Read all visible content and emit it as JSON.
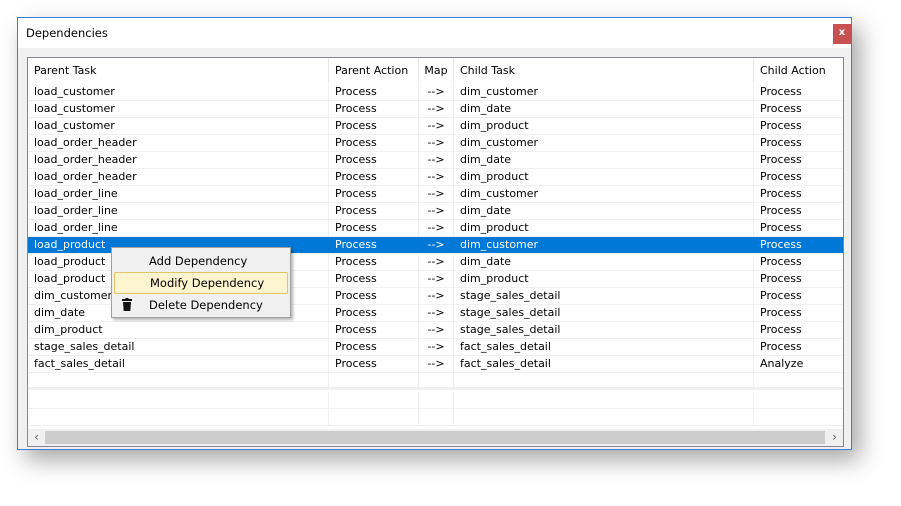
{
  "window": {
    "title": "Dependencies",
    "close_label": "x"
  },
  "columns": [
    "Parent Task",
    "Parent Action",
    "Map",
    "Child Task",
    "Child Action"
  ],
  "rows": [
    [
      "load_customer",
      "Process",
      "-->",
      "dim_customer",
      "Process"
    ],
    [
      "load_customer",
      "Process",
      "-->",
      "dim_date",
      "Process"
    ],
    [
      "load_customer",
      "Process",
      "-->",
      "dim_product",
      "Process"
    ],
    [
      "load_order_header",
      "Process",
      "-->",
      "dim_customer",
      "Process"
    ],
    [
      "load_order_header",
      "Process",
      "-->",
      "dim_date",
      "Process"
    ],
    [
      "load_order_header",
      "Process",
      "-->",
      "dim_product",
      "Process"
    ],
    [
      "load_order_line",
      "Process",
      "-->",
      "dim_customer",
      "Process"
    ],
    [
      "load_order_line",
      "Process",
      "-->",
      "dim_date",
      "Process"
    ],
    [
      "load_order_line",
      "Process",
      "-->",
      "dim_product",
      "Process"
    ],
    [
      "load_product",
      "Process",
      "-->",
      "dim_customer",
      "Process"
    ],
    [
      "load_product",
      "Process",
      "-->",
      "dim_date",
      "Process"
    ],
    [
      "load_product",
      "Process",
      "-->",
      "dim_product",
      "Process"
    ],
    [
      "dim_customer",
      "Process",
      "-->",
      "stage_sales_detail",
      "Process"
    ],
    [
      "dim_date",
      "Process",
      "-->",
      "stage_sales_detail",
      "Process"
    ],
    [
      "dim_product",
      "Process",
      "-->",
      "stage_sales_detail",
      "Process"
    ],
    [
      "stage_sales_detail",
      "Process",
      "-->",
      "fact_sales_detail",
      "Process"
    ],
    [
      "fact_sales_detail",
      "Process",
      "-->",
      "fact_sales_detail",
      "Analyze"
    ]
  ],
  "selected_row": 9,
  "context_menu": {
    "items": [
      {
        "label": "Add Dependency"
      },
      {
        "label": "Modify Dependency",
        "highlighted": true
      },
      {
        "label": "Delete Dependency",
        "icon": "trash-icon"
      }
    ]
  },
  "colors": {
    "selection": "#0078d7",
    "close": "#c75050"
  }
}
